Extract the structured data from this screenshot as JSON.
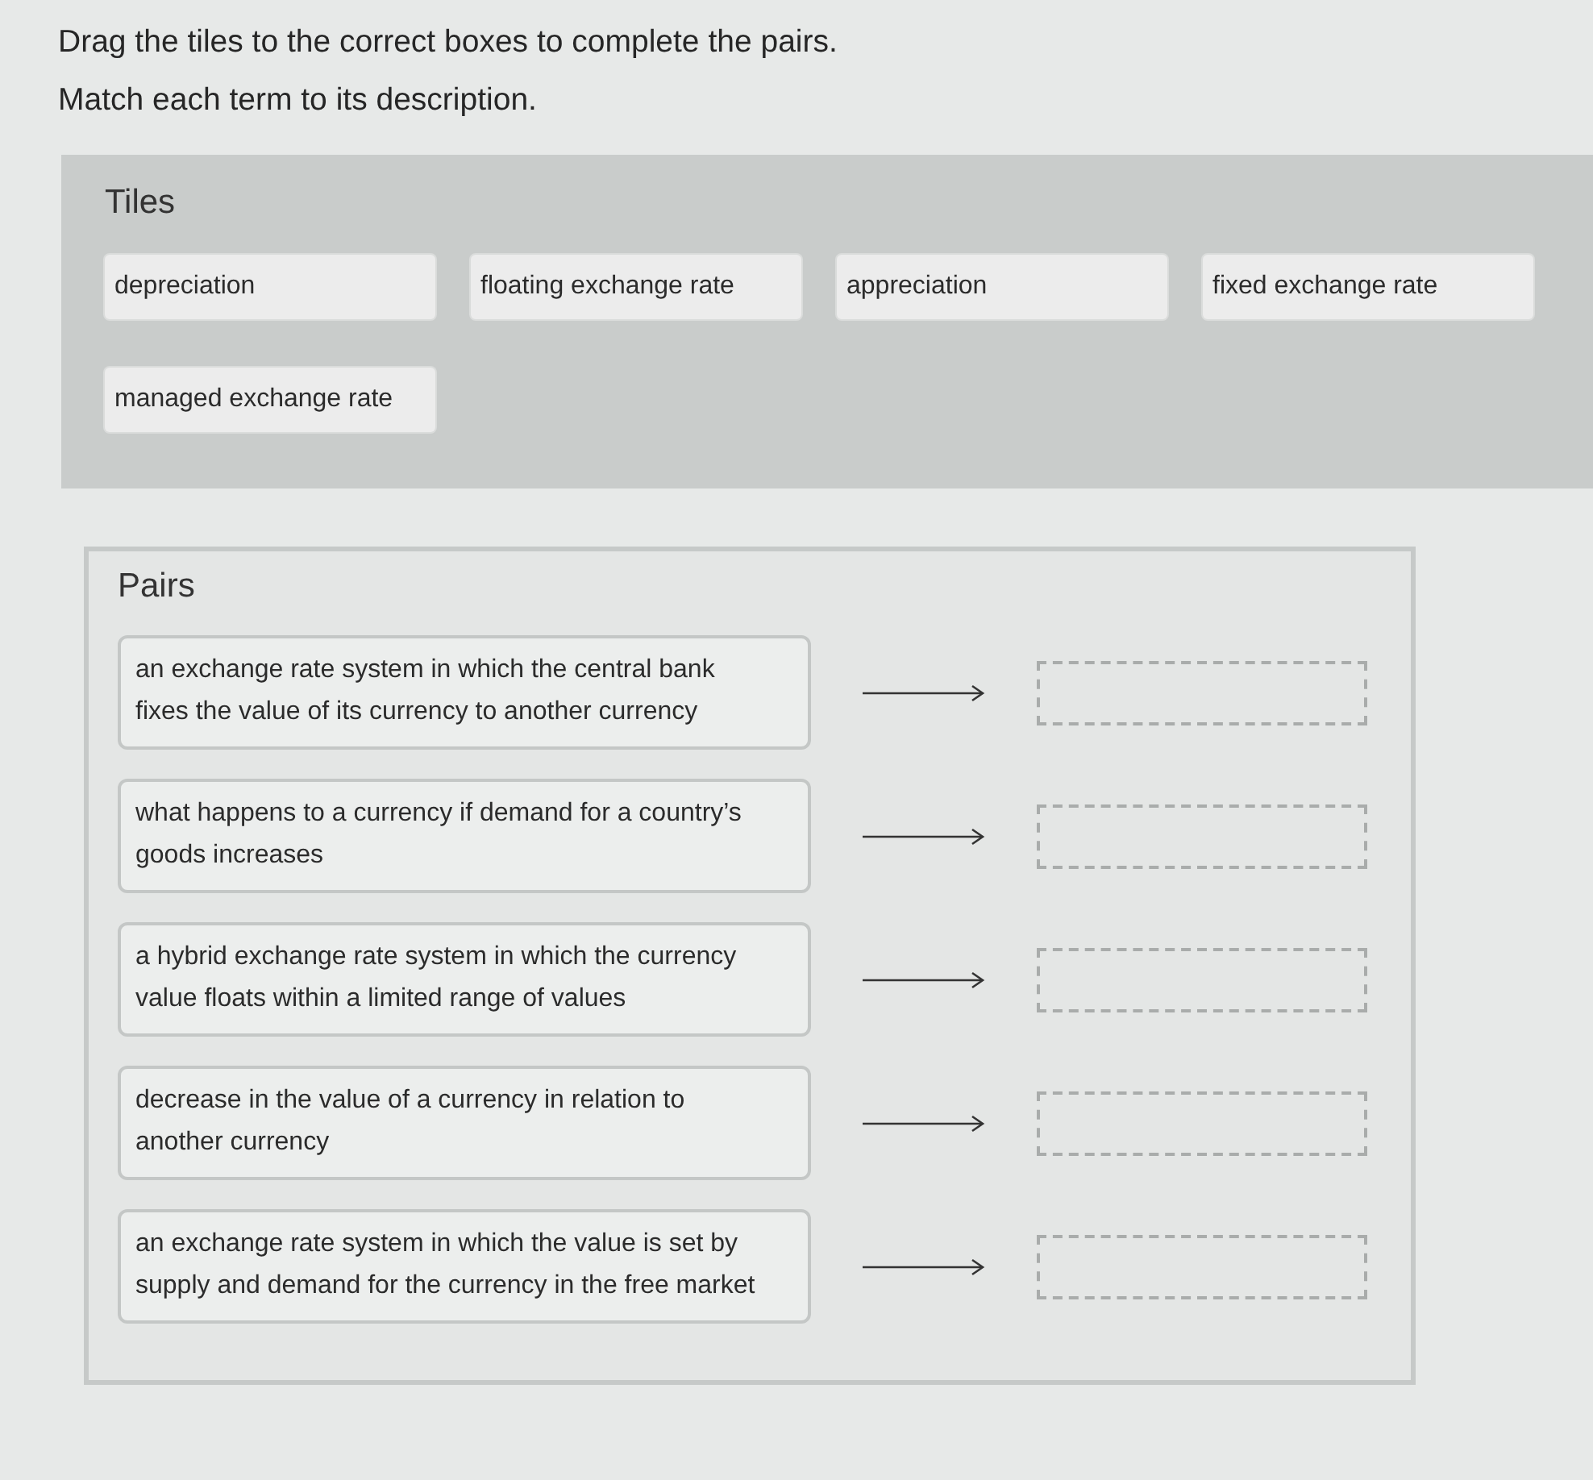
{
  "instructions": [
    "Drag the tiles to the correct boxes to complete the pairs.",
    "Match each term to its description."
  ],
  "tiles": {
    "title": "Tiles",
    "items": [
      "depreciation",
      "floating exchange rate",
      "appreciation",
      "fixed exchange rate",
      "managed exchange rate"
    ]
  },
  "pairs": {
    "title": "Pairs",
    "items": [
      {
        "description": "an exchange rate system in which the central bank fixes the value of its currency to another currency"
      },
      {
        "description": "what happens to a currency if demand for a country’s goods increases"
      },
      {
        "description": "a hybrid exchange rate system in which the currency value floats within a limited range of values"
      },
      {
        "description": "decrease in the value of a currency in relation to another currency"
      },
      {
        "description": "an exchange rate system in which the value is set by supply and demand for the currency in the free market"
      }
    ]
  }
}
